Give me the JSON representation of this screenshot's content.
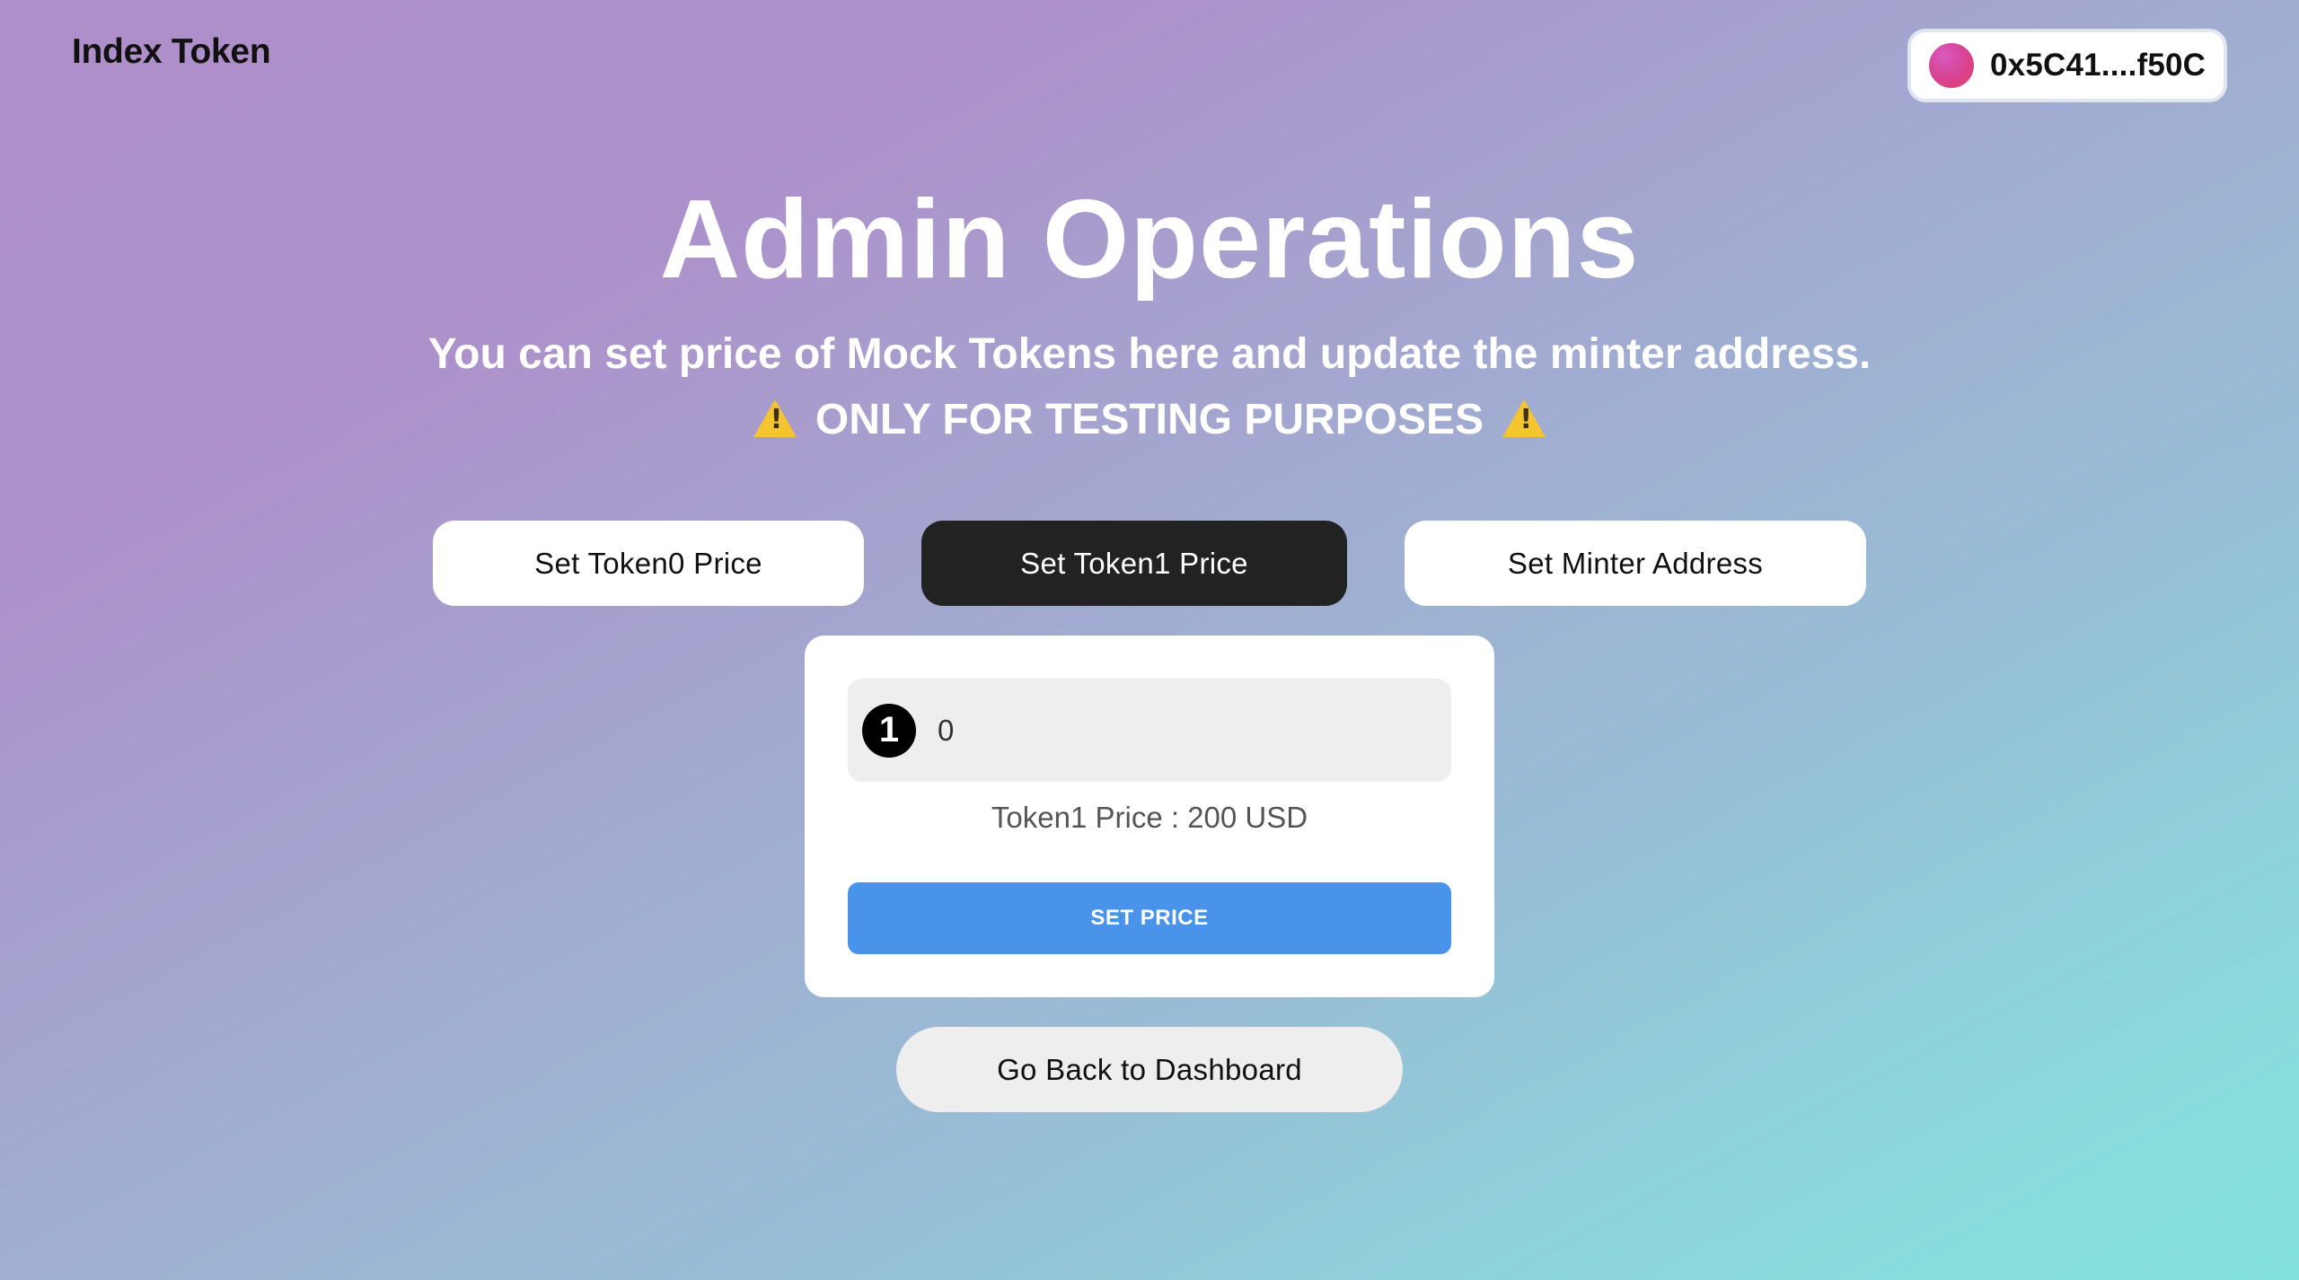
{
  "header": {
    "brand": "Index Token",
    "wallet_address": "0x5C41....f50C"
  },
  "hero": {
    "title": "Admin Operations",
    "subtitle": "You can set price of Mock Tokens here and update the minter address.",
    "warning": "ONLY FOR TESTING PURPOSES"
  },
  "tabs": [
    {
      "label": "Set Token0 Price",
      "active": false
    },
    {
      "label": "Set Token1 Price",
      "active": true
    },
    {
      "label": "Set Minter Address",
      "active": false
    }
  ],
  "form": {
    "token_icon": "1",
    "price_input_value": "0",
    "current_price_label": "Token1 Price : 200 USD",
    "submit_label": "SET PRICE"
  },
  "footer": {
    "back_label": "Go Back to Dashboard"
  },
  "icons": {
    "wallet_avatar": "wallet-avatar-icon",
    "warning": "warning-icon",
    "token": "token-1-icon"
  },
  "colors": {
    "primary_button": "#4a93ea",
    "active_tab": "#222222"
  }
}
